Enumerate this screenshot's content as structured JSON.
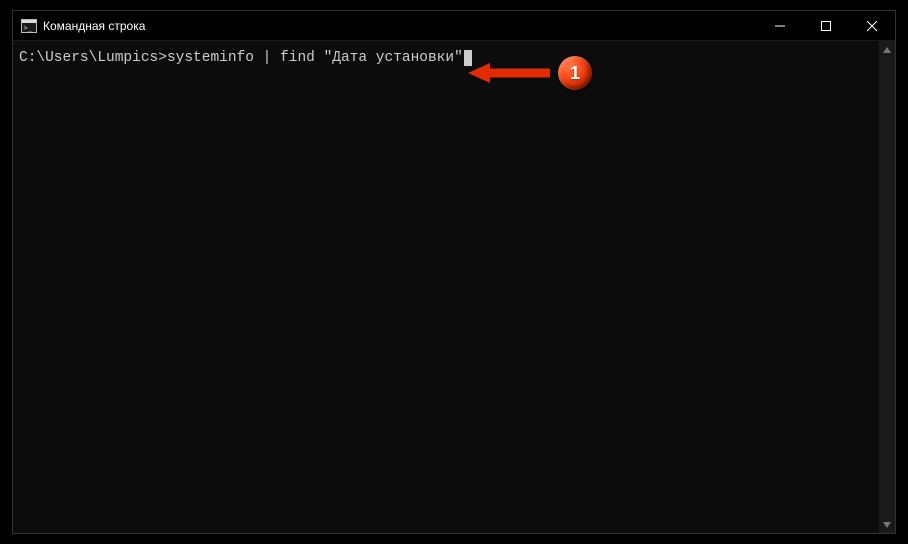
{
  "window": {
    "title": "Командная строка"
  },
  "terminal": {
    "prompt": "C:\\Users\\Lumpics>",
    "command": "systeminfo | find \"Дата установки\""
  },
  "annotation": {
    "badge_number": "1"
  }
}
